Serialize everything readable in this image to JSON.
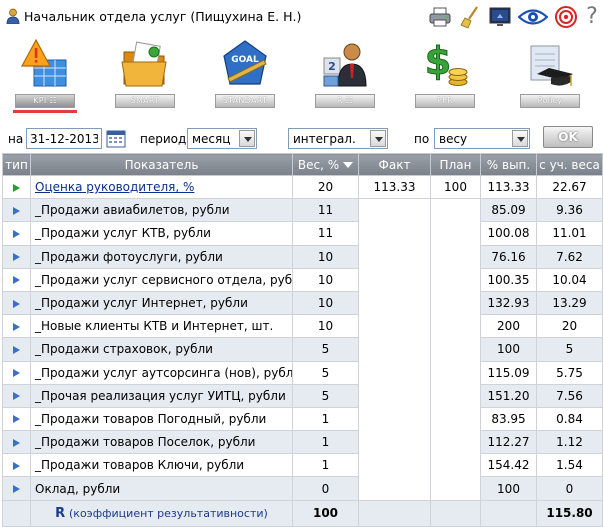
{
  "header": {
    "title": "Начальник отдела услуг  (Пищухина Е. Н.)",
    "tools": [
      "printer-icon",
      "broom-icon",
      "monitor-icon",
      "eye-icon",
      "target-icon",
      "help-icon"
    ],
    "help_label": "?"
  },
  "modules": [
    {
      "label": "KPI ☷",
      "icon": "kpi-warning-icon",
      "active": true
    },
    {
      "label": "SMART",
      "icon": "folder-icon",
      "active": false
    },
    {
      "label": "STANDART",
      "icon": "goal-badge-icon",
      "active": false
    },
    {
      "label": "R ☷",
      "icon": "manager-icon",
      "active": false
    },
    {
      "label": "PFR",
      "icon": "money-icon",
      "active": false
    },
    {
      "label": "Policy",
      "icon": "diploma-icon",
      "active": false
    }
  ],
  "filters": {
    "date_label": "на",
    "date_value": "31-12-2013",
    "period_label": "период",
    "period_value": "месяц",
    "mode_value": "интеграл.",
    "by_label": "по",
    "by_value": "весу",
    "ok_label": "OK"
  },
  "table": {
    "headers": {
      "type": "тип",
      "indicator": "Показатель",
      "weight": "Вес, %",
      "fact": "Факт",
      "plan": "План",
      "pct": "% вып.",
      "weighted": "с уч. веса"
    },
    "rows": [
      {
        "indicator": "Оценка руководителя, %",
        "weight": "20",
        "fact": "113.33",
        "plan": "100",
        "pct": "113.33",
        "weighted": "22.67",
        "link": true,
        "green": true
      },
      {
        "indicator": "_Продажи авиабилетов, рубли",
        "weight": "11",
        "fact": "",
        "plan": "",
        "pct": "85.09",
        "weighted": "9.36"
      },
      {
        "indicator": "_Продажи услуг КТВ, рубли",
        "weight": "11",
        "fact": "",
        "plan": "",
        "pct": "100.08",
        "weighted": "11.01"
      },
      {
        "indicator": "_Продажи фотоуслуги, рубли",
        "weight": "10",
        "fact": "",
        "plan": "",
        "pct": "76.16",
        "weighted": "7.62"
      },
      {
        "indicator": "_Продажи услуг сервисного отдела, рубли",
        "weight": "10",
        "fact": "",
        "plan": "",
        "pct": "100.35",
        "weighted": "10.04"
      },
      {
        "indicator": "_Продажи услуг Интернет, рубли",
        "weight": "10",
        "fact": "",
        "plan": "",
        "pct": "132.93",
        "weighted": "13.29"
      },
      {
        "indicator": "_Новые клиенты КТВ и Интернет, шт.",
        "weight": "10",
        "fact": "",
        "plan": "",
        "pct": "200",
        "weighted": "20"
      },
      {
        "indicator": "_Продажи страховок, рубли",
        "weight": "5",
        "fact": "",
        "plan": "",
        "pct": "100",
        "weighted": "5"
      },
      {
        "indicator": "_Продажи услуг аутсорсинга (нов), рубли",
        "weight": "5",
        "fact": "",
        "plan": "",
        "pct": "115.09",
        "weighted": "5.75"
      },
      {
        "indicator": "_Прочая реализация услуг УИТЦ, рубли",
        "weight": "5",
        "fact": "",
        "plan": "",
        "pct": "151.20",
        "weighted": "7.56"
      },
      {
        "indicator": "_Продажи товаров Погодный, рубли",
        "weight": "1",
        "fact": "",
        "plan": "",
        "pct": "83.95",
        "weighted": "0.84"
      },
      {
        "indicator": "_Продажи товаров Поселок, рубли",
        "weight": "1",
        "fact": "",
        "plan": "",
        "pct": "112.27",
        "weighted": "1.12"
      },
      {
        "indicator": "_Продажи товаров Ключи, рубли",
        "weight": "1",
        "fact": "",
        "plan": "",
        "pct": "154.42",
        "weighted": "1.54"
      },
      {
        "indicator": "Оклад, рубли",
        "weight": "0",
        "fact": "",
        "plan": "",
        "pct": "100",
        "weighted": "0"
      }
    ],
    "footer": {
      "r_label": "R",
      "r_caption": "(коэффициент результативности)",
      "weight_total": "100",
      "weighted_total": "115.80"
    }
  },
  "colors": {
    "header_bg": "#8a9099",
    "row_alt": "#e6ebf1",
    "link": "#0b2f8a",
    "triangle_blue": "#3b6fc9",
    "triangle_green": "#22a322",
    "active_underline": "#e23c3c"
  }
}
